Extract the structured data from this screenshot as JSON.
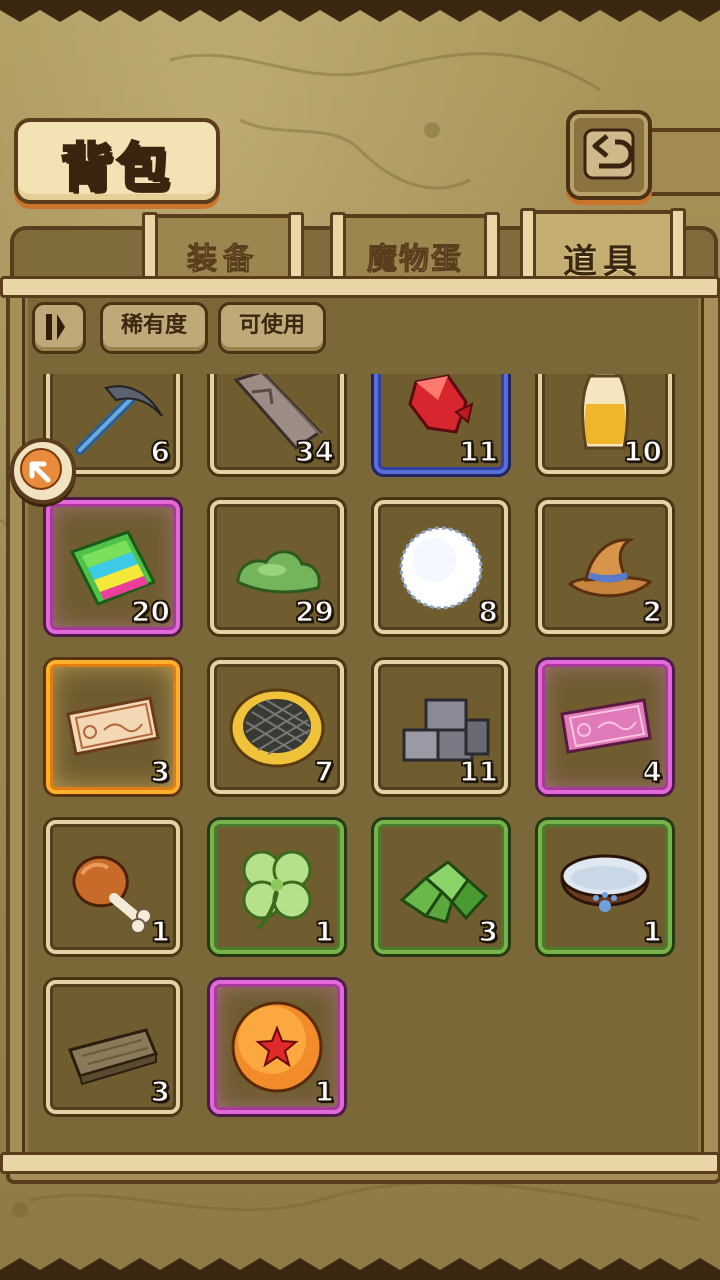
{
  "title": "背包",
  "tabs": [
    {
      "label": "装备",
      "active": false
    },
    {
      "label": "魔物蛋",
      "active": false
    },
    {
      "label": "道具",
      "active": true
    }
  ],
  "filters": {
    "rarity_label": "稀有度",
    "usable_label": "可使用"
  },
  "icons": {
    "back": "back-arrow-icon",
    "sort": "sort-toggle-icon",
    "side": "collapse-arrow-icon"
  },
  "colors": {
    "rarity_blue": "#5a6ed8",
    "rarity_purple": "#e26ad8",
    "rarity_orange": "#ffb12c",
    "rarity_green": "#78b24a"
  },
  "items": [
    {
      "name": "pickaxe",
      "count": "6",
      "rarity": "common"
    },
    {
      "name": "stone-slab",
      "count": "34",
      "rarity": "common"
    },
    {
      "name": "red-crystal",
      "count": "11",
      "rarity": "blue"
    },
    {
      "name": "potion-bottle",
      "count": "10",
      "rarity": "common"
    },
    {
      "name": "rainbow-cake",
      "count": "20",
      "rarity": "purple"
    },
    {
      "name": "green-slime",
      "count": "29",
      "rarity": "common"
    },
    {
      "name": "snowball",
      "count": "8",
      "rarity": "common"
    },
    {
      "name": "witch-hat",
      "count": "2",
      "rarity": "common"
    },
    {
      "name": "gold-ticket",
      "count": "3",
      "rarity": "orange"
    },
    {
      "name": "waffle-cookie",
      "count": "7",
      "rarity": "common"
    },
    {
      "name": "stone-bricks",
      "count": "11",
      "rarity": "common"
    },
    {
      "name": "pink-ticket",
      "count": "4",
      "rarity": "purple"
    },
    {
      "name": "chicken-leg",
      "count": "1",
      "rarity": "common"
    },
    {
      "name": "four-leaf-clover",
      "count": "1",
      "rarity": "green"
    },
    {
      "name": "green-crystals",
      "count": "3",
      "rarity": "green"
    },
    {
      "name": "water-bowl",
      "count": "1",
      "rarity": "green"
    },
    {
      "name": "wood-plank",
      "count": "3",
      "rarity": "common"
    },
    {
      "name": "star-ball",
      "count": "1",
      "rarity": "purple"
    }
  ]
}
